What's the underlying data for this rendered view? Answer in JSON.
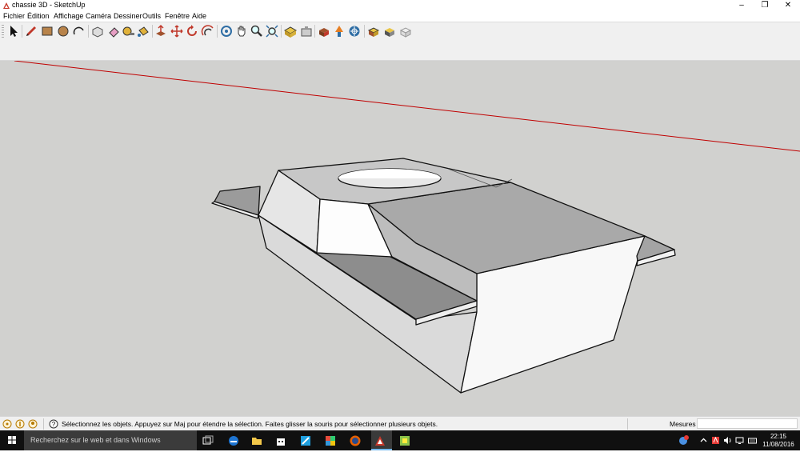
{
  "window": {
    "title": "chassie 3D - SketchUp",
    "buttons": [
      "minimize",
      "maximize",
      "close"
    ]
  },
  "menu": [
    "Fichier",
    "Édition",
    "Affichage",
    "Caméra",
    "Dessiner",
    "Outils",
    "Fenêtre",
    "Aide"
  ],
  "toolbar": {
    "tools": [
      "select-icon",
      "pencil-icon",
      "rectangle-icon",
      "circle-icon",
      "arc-icon",
      "make-component-icon",
      "eraser-icon",
      "tape-measure-icon",
      "paint-bucket-icon",
      "push-pull-icon",
      "move-icon",
      "rotate-icon",
      "offset-icon",
      "orbit-icon",
      "pan-icon",
      "zoom-icon",
      "zoom-extents-icon",
      "3d-warehouse-icon",
      "share-model-icon",
      "get-models-icon",
      "send-to-layout-icon",
      "extension-warehouse-icon",
      "extension-manager-icon",
      "section-icon",
      "styles-icon"
    ]
  },
  "status": {
    "hint": "Sélectionnez les objets. Appuyez sur Maj pour étendre la sélection. Faites glisser la souris pour sélectionner plusieurs objets.",
    "measurements_label": "Mesures",
    "measurements_value": ""
  },
  "taskbar": {
    "search_placeholder": "Recherchez sur le web et dans Windows",
    "apps": [
      "task-view-icon",
      "edge-icon",
      "file-explorer-icon",
      "store-icon",
      "app-blue-icon",
      "app-colorful-icon",
      "firefox-icon",
      "sketchup-icon",
      "app-square-icon"
    ],
    "time": "22:15",
    "date": "11/08/2016"
  },
  "colors": {
    "viewport_bg": "#d1d1cf",
    "axis_red": "#c00000",
    "toolbar_bg": "#f0f0f0",
    "taskbar_bg": "#101010"
  }
}
